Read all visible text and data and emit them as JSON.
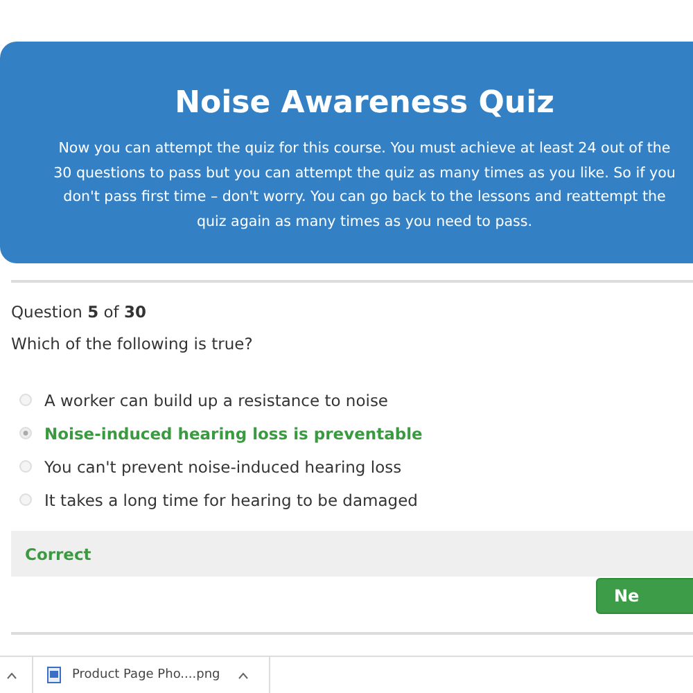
{
  "banner": {
    "title": "Noise Awareness Quiz",
    "text": "Now you can attempt the quiz for this course. You must achieve at least 24 out of the 30 questions to pass but you can attempt the quiz as many times as you like. So if you don't pass first time – don't worry. You can go back to the lessons and reattempt the quiz again as many times as you need to pass."
  },
  "question": {
    "counter": "Question **5** of **30**",
    "text": "Which of the following is true?",
    "options": [
      {
        "label": "A worker can build up a resistance to noise",
        "selected": false
      },
      {
        "label": "Noise-induced hearing loss is preventable",
        "selected": true
      },
      {
        "label": "You can't prevent noise-induced hearing loss",
        "selected": false
      },
      {
        "label": "It takes a long time for hearing to be damaged",
        "selected": false
      }
    ]
  },
  "feedback": {
    "kind": "correct",
    "text": "Correct"
  },
  "next_button": "Ne",
  "download_bar": {
    "items": [
      {
        "name": "Product Page Pho....png"
      }
    ]
  }
}
